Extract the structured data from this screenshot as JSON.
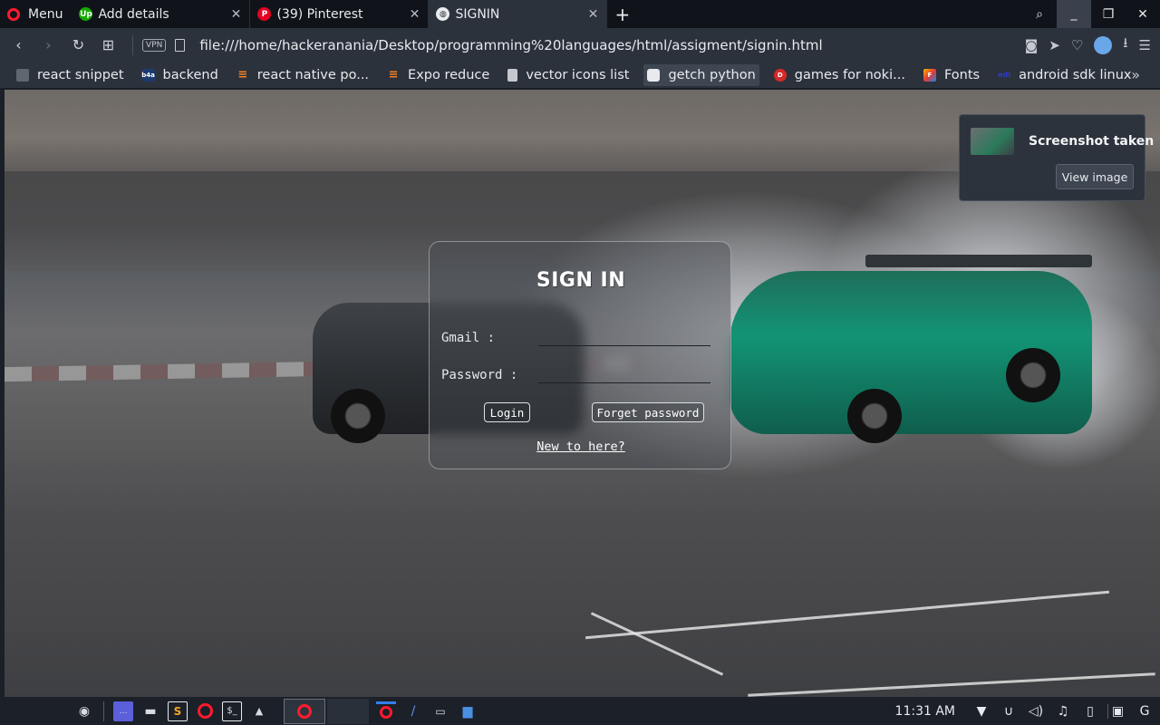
{
  "browser": {
    "menu_label": "Menu",
    "tabs": [
      {
        "title": "Add details",
        "favicon": "upwork",
        "color": "#14a800"
      },
      {
        "title": "(39) Pinterest",
        "favicon": "pinterest",
        "color": "#e60023"
      },
      {
        "title": "SIGNIN",
        "favicon": "globe",
        "color": "#5f6b7a"
      }
    ],
    "url": "file:///home/hackeranania/Desktop/programming%20languages/html/assigment/signin.html",
    "vpn_label": "VPN"
  },
  "bookmarks": [
    {
      "label": "react snippet",
      "icon": "page",
      "color": "#5f6670"
    },
    {
      "label": "backend",
      "icon": "b4a",
      "color": "#1d3a6e"
    },
    {
      "label": "react native po...",
      "icon": "stackoverflow",
      "color": "#f48024"
    },
    {
      "label": "Expo reduce",
      "icon": "stackoverflow",
      "color": "#f48024"
    },
    {
      "label": "vector icons list",
      "icon": "document",
      "color": "#c5c9cf"
    },
    {
      "label": "getch python",
      "icon": "cube",
      "color": "#e8eaed"
    },
    {
      "label": "games for noki...",
      "icon": "dingbat",
      "color": "#d62828"
    },
    {
      "label": "Fonts",
      "icon": "fonts",
      "color": "#f5b400"
    },
    {
      "label": "android sdk linux",
      "icon": "edi",
      "color": "#2b3acf"
    }
  ],
  "toast": {
    "title": "Screenshot taken",
    "button": "View image"
  },
  "signin": {
    "title": "SIGN IN",
    "gmail_label": "Gmail :",
    "gmail_value": "",
    "password_label": "Password :",
    "password_value": "",
    "login_button": "Login",
    "forget_button": "Forget password",
    "register_link": "New to here?"
  },
  "taskbar": {
    "clock": "11:31 AM"
  },
  "colors": {
    "opera_red": "#ff1b2d",
    "chrome_bg": "#2b323c",
    "tabbar_bg": "#10141a"
  }
}
